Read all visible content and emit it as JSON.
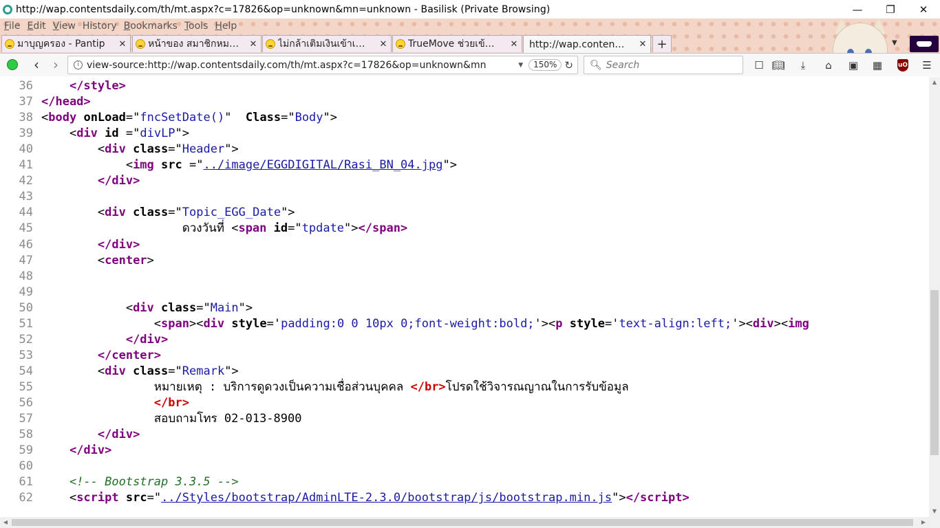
{
  "window": {
    "title": "http://wap.contentsdaily.com/th/mt.aspx?c=17826&op=unknown&mn=unknown - Basilisk (Private Browsing)",
    "minimize": "—",
    "maximize": "❐",
    "close": "✕"
  },
  "menu": [
    {
      "acc": "F",
      "rest": "ile"
    },
    {
      "acc": "E",
      "rest": "dit"
    },
    {
      "acc": "V",
      "rest": "iew"
    },
    {
      "acc": "",
      "rest": "History"
    },
    {
      "acc": "B",
      "rest": "ookmarks"
    },
    {
      "acc": "T",
      "rest": "ools"
    },
    {
      "acc": "H",
      "rest": "elp"
    }
  ],
  "tabs": [
    {
      "label": "มาบุญครอง - Pantip",
      "active": false
    },
    {
      "label": "หน้าของ สมาชิกหม…",
      "active": false
    },
    {
      "label": "ไม่กล้าเติมเงินเข้าเ…",
      "active": false
    },
    {
      "label": "TrueMove ช่วยเข้…",
      "active": false
    },
    {
      "label": "http://wap.conten…",
      "active": true
    }
  ],
  "tab_close": "✕",
  "new_tab": "+",
  "navbar": {
    "url": "view-source:http://wap.contentsdaily.com/th/mt.aspx?c=17826&op=unknown&mn",
    "zoom": "150%",
    "search_placeholder": "Search"
  },
  "source_lines": [
    {
      "n": "36",
      "html": "    <span class='tag'>&lt;/style&gt;</span>"
    },
    {
      "n": "37",
      "html": "<span class='tag'>&lt;/head&gt;</span>"
    },
    {
      "n": "38",
      "html": "&lt;<span class='tag'>body</span> <span class='attr'>onLoad</span>=\"<span class='val'>fncSetDate()</span>\"  <span class='attr'>Class</span>=\"<span class='val'>Body</span>\"&gt;"
    },
    {
      "n": "39",
      "html": "    &lt;<span class='tag'>div</span> <span class='attr'>id</span> =\"<span class='val'>divLP</span>\"&gt;"
    },
    {
      "n": "40",
      "html": "        &lt;<span class='tag'>div</span> <span class='attr'>class</span>=\"<span class='val'>Header</span>\"&gt;"
    },
    {
      "n": "41",
      "html": "            &lt;<span class='tag'>img</span> <span class='attr'>src</span> =\"<span class='link'>../image/EGGDIGITAL/Rasi_BN_04.jpg</span>\"&gt;"
    },
    {
      "n": "42",
      "html": "        <span class='tag'>&lt;/div&gt;</span>"
    },
    {
      "n": "43",
      "html": ""
    },
    {
      "n": "44",
      "html": "        &lt;<span class='tag'>div</span> <span class='attr'>class</span>=\"<span class='val'>Topic_EGG_Date</span>\"&gt;"
    },
    {
      "n": "45",
      "html": "                    <span class='thai'>ดวงวันที่</span> &lt;<span class='tag'>span</span> <span class='attr'>id</span>=\"<span class='val'>tpdate</span>\"&gt;<span class='tag'>&lt;/span&gt;</span>"
    },
    {
      "n": "46",
      "html": "        <span class='tag'>&lt;/div&gt;</span>"
    },
    {
      "n": "47",
      "html": "        &lt;<span class='tag'>center</span>&gt;"
    },
    {
      "n": "48",
      "html": ""
    },
    {
      "n": "49",
      "html": ""
    },
    {
      "n": "50",
      "html": "            &lt;<span class='tag'>div</span> <span class='attr'>class</span>=\"<span class='val'>Main</span>\"&gt;"
    },
    {
      "n": "51",
      "html": "                &lt;<span class='tag'>span</span>&gt;&lt;<span class='tag'>div</span> <span class='attr'>style</span>='<span class='val'>padding:0 0 10px 0;font-weight:bold;</span>'&gt;&lt;<span class='tag'>p</span> <span class='attr'>style</span>='<span class='val'>text-align:left;</span>'&gt;&lt;<span class='tag'>div</span>&gt;&lt;<span class='tag'>img</span>"
    },
    {
      "n": "52",
      "html": "            <span class='tag'>&lt;/div&gt;</span>"
    },
    {
      "n": "53",
      "html": "        <span class='tag'>&lt;/center&gt;</span>"
    },
    {
      "n": "54",
      "html": "        &lt;<span class='tag'>div</span> <span class='attr'>class</span>=\"<span class='val'>Remark</span>\"&gt;"
    },
    {
      "n": "55",
      "html": "                <span class='thai'>หมายเหตุ</span> : <span class='thai'>บริการดูดวงเป็นความเชื่อส่วนบุคคล</span> <span class='err'>&lt;/br&gt;</span><span class='thai'>โปรดใช้วิจารณญาณในการรับข้อมูล</span>"
    },
    {
      "n": "56",
      "html": "                <span class='err'>&lt;/br&gt;</span>"
    },
    {
      "n": "57",
      "html": "                <span class='thai'>สอบถามโทร</span> 02-013-8900"
    },
    {
      "n": "58",
      "html": "        <span class='tag'>&lt;/div&gt;</span>"
    },
    {
      "n": "59",
      "html": "    <span class='tag'>&lt;/div&gt;</span>"
    },
    {
      "n": "60",
      "html": ""
    },
    {
      "n": "61",
      "html": "    <span class='cmt'>&lt;!-- Bootstrap 3.3.5 --&gt;</span>"
    },
    {
      "n": "62",
      "html": "    &lt;<span class='tag'>script</span> <span class='attr'>src</span>=\"<span class='link'>../Styles/bootstrap/AdminLTE-2.3.0/bootstrap/js/bootstrap.min.js</span>\"&gt;<span class='tag'>&lt;/script&gt;</span>"
    }
  ],
  "icons": {
    "app": "basilisk-icon",
    "status": "green-status-icon",
    "back": "back-arrow-icon",
    "forward": "forward-arrow-icon",
    "bookmark_star": "bookmark-icon",
    "library": "library-icon",
    "downloads": "download-icon",
    "home": "home-icon",
    "ublock": "ublock-icon",
    "menu": "hamburger-icon"
  },
  "colors": {
    "tag": "#7f007f",
    "attribute_value": "#1a1aa6",
    "comment": "#236e25",
    "error": "#cc0000",
    "line_number": "#8b8b8b",
    "private_mask": "#25003e"
  }
}
